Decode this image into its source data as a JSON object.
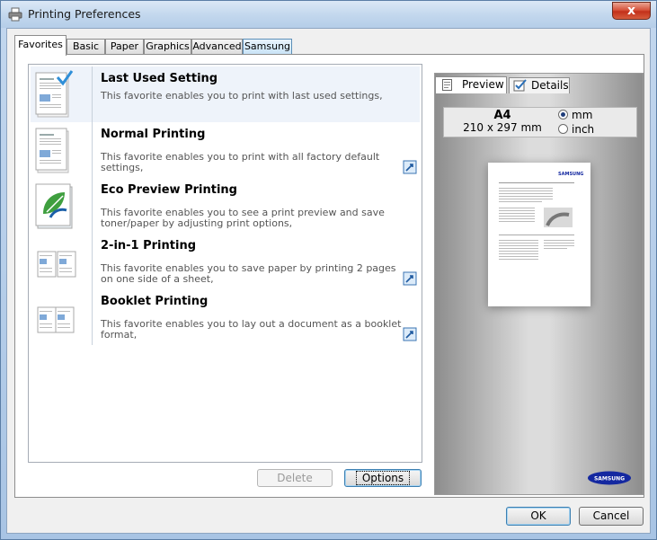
{
  "window": {
    "title": "Printing Preferences",
    "close_glyph": "x"
  },
  "tabs": [
    {
      "label": "Favorites",
      "active": true
    },
    {
      "label": "Basic"
    },
    {
      "label": "Paper"
    },
    {
      "label": "Graphics"
    },
    {
      "label": "Advanced"
    },
    {
      "label": "Samsung"
    }
  ],
  "favorites": [
    {
      "name": "Last Used Setting",
      "desc": "This favorite enables you to print with last used settings,",
      "selected": true
    },
    {
      "name": "Normal Printing",
      "desc": "This favorite enables you to print with all factory default settings,"
    },
    {
      "name": "Eco Preview Printing",
      "desc": "This favorite enables you to see a print preview and save toner/paper by adjusting print options,"
    },
    {
      "name": "2-in-1 Printing",
      "desc": "This favorite enables you to save paper by printing 2 pages on one side of a sheet,"
    },
    {
      "name": "Booklet Printing",
      "desc": "This favorite enables you to lay out a document as a booklet format,"
    }
  ],
  "buttons": {
    "delete": "Delete",
    "options": "Options",
    "ok": "OK",
    "cancel": "Cancel"
  },
  "preview": {
    "tabs": [
      {
        "label": "Preview",
        "active": true
      },
      {
        "label": "Details"
      }
    ],
    "paper_size": "A4",
    "paper_dims": "210 x 297 mm",
    "units": [
      {
        "label": "mm",
        "selected": true
      },
      {
        "label": "inch"
      }
    ],
    "page_logo": "SAMSUNG",
    "brand_logo": "SAMSUNG"
  },
  "colors": {
    "brand": "#1428a0",
    "accent": "#3c7fb1",
    "close": "#c3301a"
  }
}
